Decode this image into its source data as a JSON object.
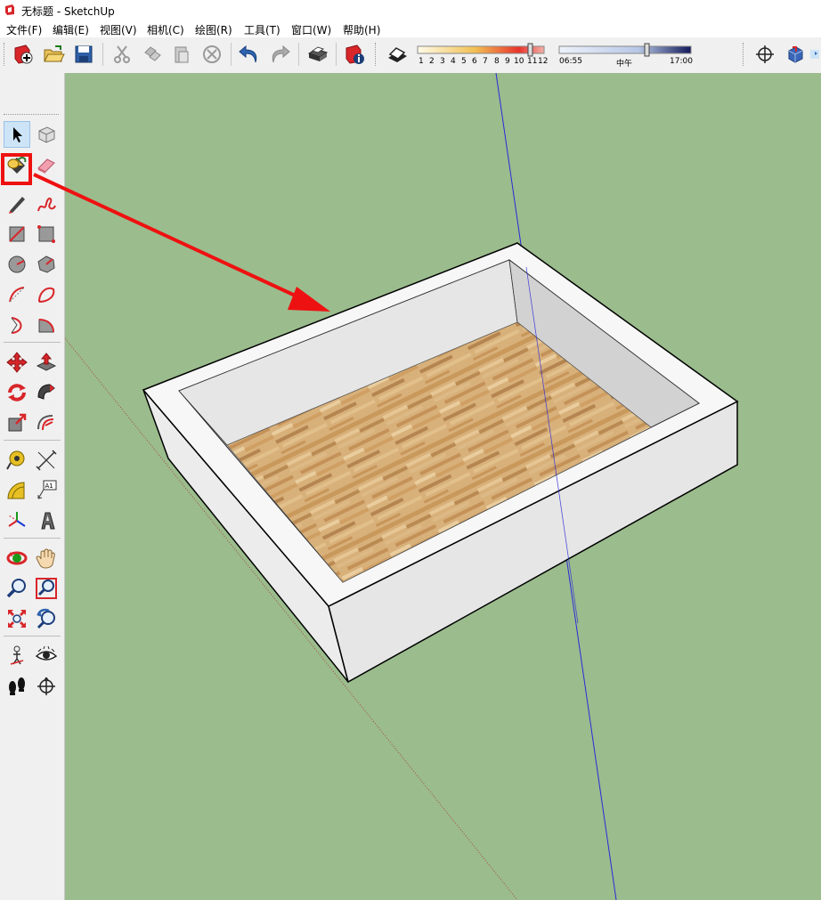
{
  "window": {
    "title": "无标题 - SketchUp"
  },
  "menu": [
    {
      "id": "file",
      "label": "文件(F)"
    },
    {
      "id": "edit",
      "label": "编辑(E)"
    },
    {
      "id": "view",
      "label": "视图(V)"
    },
    {
      "id": "camera",
      "label": "相机(C)"
    },
    {
      "id": "draw",
      "label": "绘图(R)"
    },
    {
      "id": "tools",
      "label": "工具(T)"
    },
    {
      "id": "window",
      "label": "窗口(W)"
    },
    {
      "id": "help",
      "label": "帮助(H)"
    }
  ],
  "toolbar": {
    "buttons": [
      "new-icon",
      "open-folder-icon",
      "save-icon",
      "cut-icon",
      "copy-icon",
      "paste-icon",
      "erase-icon",
      "undo-icon",
      "redo-icon",
      "print-icon",
      "model-info-icon",
      "shadows-icon",
      "orbit-icon",
      "views-icon"
    ],
    "months": [
      "1",
      "2",
      "3",
      "4",
      "5",
      "6",
      "7",
      "8",
      "9",
      "10",
      "11",
      "12"
    ],
    "time_start": "06:55",
    "time_noon": "中午",
    "time_end": "17:00"
  },
  "left_tools": [
    "select-icon",
    "component-icon",
    "paint-bucket-icon",
    "eraser-icon",
    "pencil-line-icon",
    "freehand-icon",
    "rectangle-icon",
    "rotated-rectangle-icon",
    "circle-icon",
    "polygon-icon",
    "arc-icon",
    "two-point-arc-icon",
    "three-point-arc-icon",
    "pie-icon",
    "move-icon",
    "push-pull-icon",
    "rotate-icon",
    "follow-me-icon",
    "scale-icon",
    "offset-icon",
    "tape-measure-icon",
    "dimension-icon",
    "protractor-icon",
    "text-icon",
    "axes-icon",
    "3d-text-icon",
    "orbit-icon",
    "pan-icon",
    "zoom-icon",
    "zoom-window-icon",
    "zoom-extents-icon",
    "previous-view-icon",
    "position-camera-icon",
    "look-around-icon",
    "walk-icon",
    "section-plane-icon"
  ],
  "colors": {
    "ground": "#9bbc8d",
    "annotation": "#ee1111",
    "active_tool_bg": "#cde4f7"
  }
}
